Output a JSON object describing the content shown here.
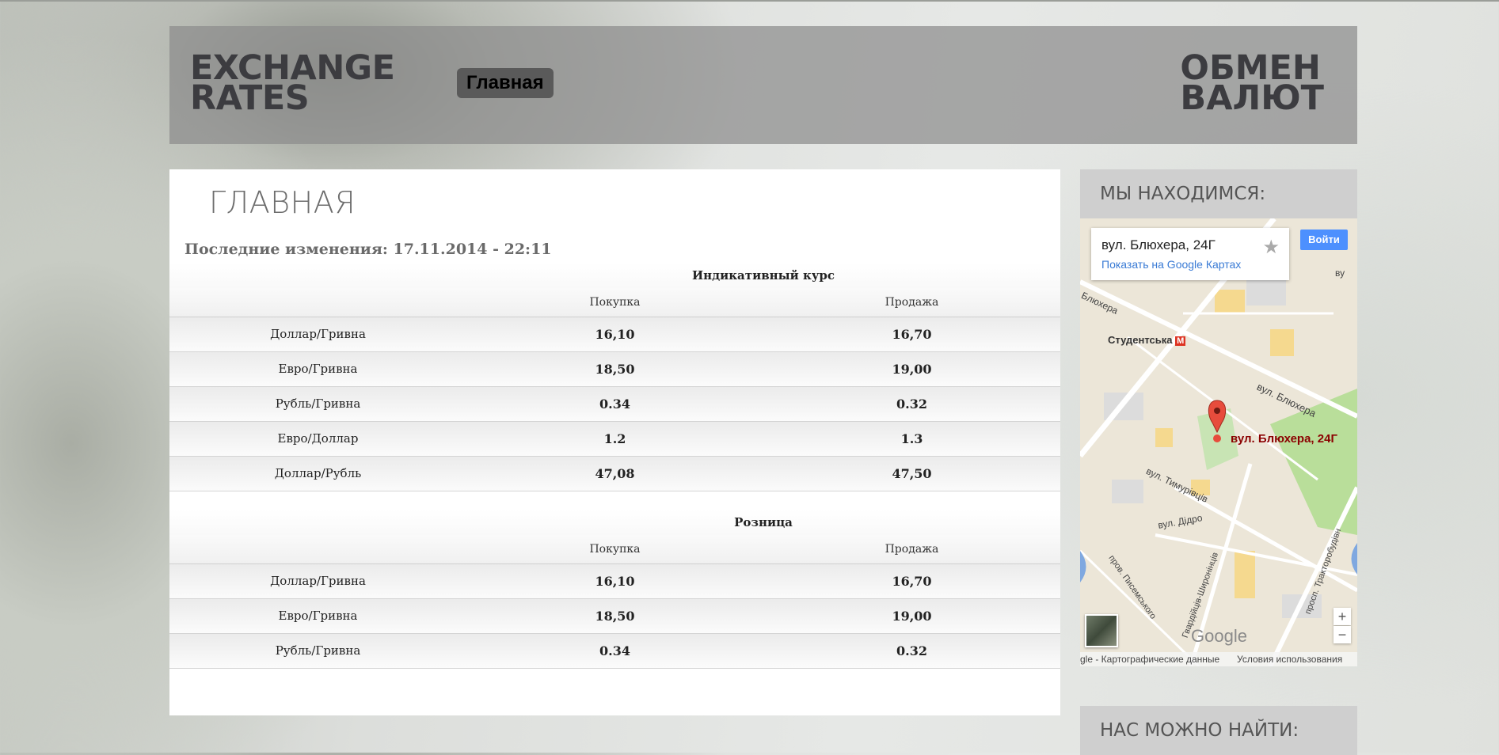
{
  "header": {
    "brand_line1": "EXCHANGE",
    "brand_line2": "RATES",
    "nav_home": "Главная",
    "right_line1": "ОБМЕН",
    "right_line2": "ВАЛЮТ"
  },
  "main": {
    "title": "ГЛАВНАЯ",
    "updated": "Последние изменения: 17.11.2014 - 22:11",
    "indicative": {
      "caption": "Индикативный курс",
      "col_buy": "Покупка",
      "col_sell": "Продажа",
      "rows": [
        {
          "pair": "Доллар/Гривна",
          "buy": "16,10",
          "sell": "16,70"
        },
        {
          "pair": "Евро/Гривна",
          "buy": "18,50",
          "sell": "19,00"
        },
        {
          "pair": "Рубль/Гривна",
          "buy": "0.34",
          "sell": "0.32"
        },
        {
          "pair": "Евро/Доллар",
          "buy": "1.2",
          "sell": "1.3"
        },
        {
          "pair": "Доллар/Рубль",
          "buy": "47,08",
          "sell": "47,50"
        }
      ]
    },
    "retail": {
      "caption": "Розница",
      "col_buy": "Покупка",
      "col_sell": "Продажа",
      "rows": [
        {
          "pair": "Доллар/Гривна",
          "buy": "16,10",
          "sell": "16,70"
        },
        {
          "pair": "Евро/Гривна",
          "buy": "18,50",
          "sell": "19,00"
        },
        {
          "pair": "Рубль/Гривна",
          "buy": "0.34",
          "sell": "0.32"
        }
      ]
    }
  },
  "sidebar": {
    "location_title": "МЫ НАХОДИМСЯ:",
    "find_us_title": "НАС МОЖНО НАЙТИ:",
    "map": {
      "address": "вул. Блюхера, 24Г",
      "show_link": "Показать на Google Картах",
      "sign_in": "Войти",
      "marker_label": "вул. Блюхера, 24Г",
      "street_1": "Блюхера",
      "metro": "Студентська",
      "street_2": "вул. Блюхера",
      "street_3": "вул. Тимурівців",
      "street_4": "вул. Дідро",
      "street_5": "пров. Писемського",
      "street_6": "Гвардійців-Широнінців",
      "street_7": "просп. Тракторобудівн",
      "street_8": "ву",
      "zoom_in": "+",
      "zoom_out": "−",
      "logo": "Google",
      "footer_data": "gle - Картографические данные",
      "footer_terms": "Условия использования"
    }
  }
}
